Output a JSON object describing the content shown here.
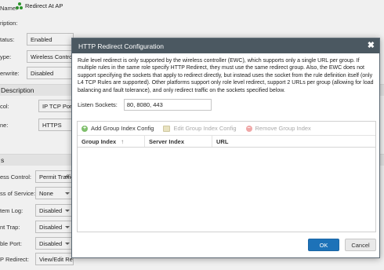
{
  "background": {
    "title": "Redirect At AP",
    "rows": [
      {
        "label": "Name:",
        "value": ""
      },
      {
        "label": "ription:",
        "value": ""
      },
      {
        "label": "tatus:",
        "value": "Enabled"
      },
      {
        "label": "ype:",
        "value": "Wireless Contro"
      },
      {
        "label": "erwrite:",
        "value": "Disabled"
      }
    ],
    "section1": "Description",
    "rows2": [
      {
        "label": "col:",
        "value": "IP TCP Por"
      },
      {
        "label": "ne:",
        "value": "HTTPS"
      }
    ],
    "section2": "s",
    "rows3": [
      {
        "label": "ess Control:",
        "value": "Permit Traffic"
      },
      {
        "label": "ss of Service:",
        "value": "None"
      },
      {
        "label": "tem Log:",
        "value": "Disabled"
      },
      {
        "label": "nt Trap:",
        "value": "Disabled"
      },
      {
        "label": "ble Port:",
        "value": "Disabled"
      },
      {
        "label": "P Redirect:",
        "value": "View/Edit Redirect Groups"
      }
    ]
  },
  "modal": {
    "title": "HTTP Redirect Configuration",
    "close_icon": "close-icon",
    "description": "Rule level redirect is only supported by the wireless controller (EWC), which supports only a single URL per group. If multiple rules in the same role specify HTTP Redirect, they must use the same redirect group. Also, the EWC does not support specifying the sockets that apply to redirect directly, but instead uses the socket from the rule definition itself (only L4 TCP Rules are supported). Other platforms support only role level redirect, support 2 URLs per group (allowing for load balancing and fault tolerance), and only redirect traffic on the sockets specified below.",
    "sockets_label": "Listen Sockets:",
    "sockets_value": "80, 8080, 443",
    "toolbar": {
      "add_label": "Add Group Index Config",
      "edit_label": "Edit Group Index Config",
      "remove_label": "Remove Group Index"
    },
    "columns": [
      "Group Index",
      "Server Index",
      "URL"
    ],
    "ok_label": "OK",
    "cancel_label": "Cancel"
  },
  "colors": {
    "header_bg": "#4b5861",
    "ok_bg": "#1d72b8"
  }
}
